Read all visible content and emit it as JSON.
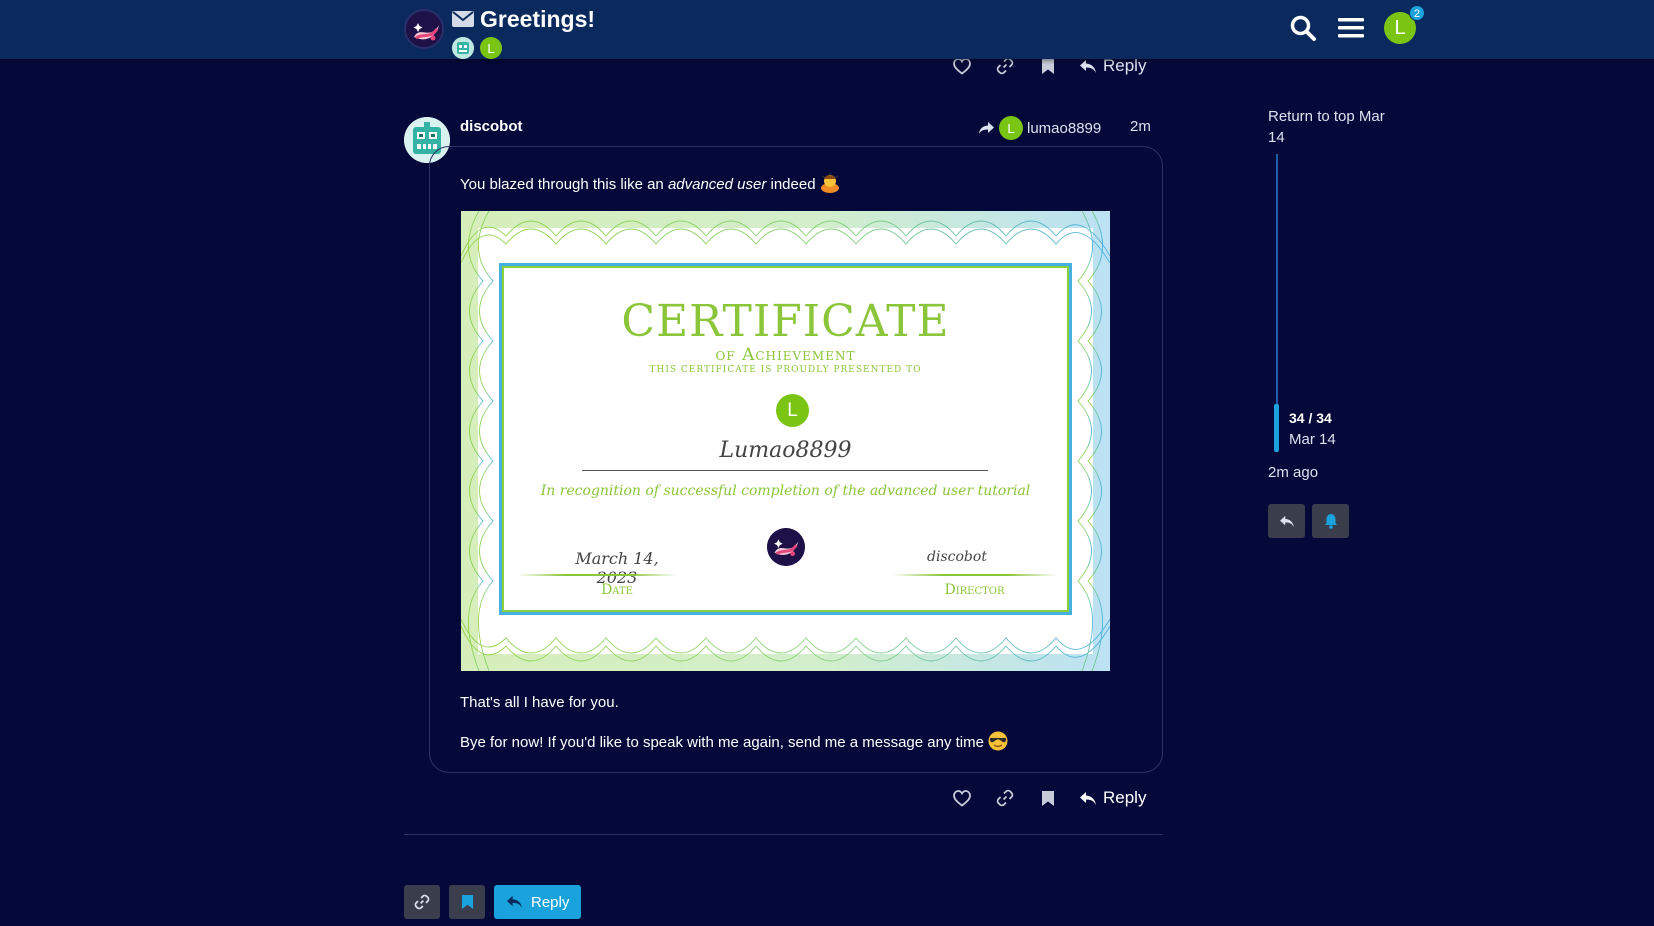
{
  "header": {
    "topic_title": "Greetings!",
    "participants": [
      {
        "name": "discobot",
        "initial": ""
      },
      {
        "name": "lumao8899",
        "initial": "L"
      }
    ],
    "user_initial": "L",
    "notification_count": "2"
  },
  "top_actions": {
    "reply_label": "Reply"
  },
  "post": {
    "username": "discobot",
    "reply_to_initial": "L",
    "reply_to_user": "lumao8899",
    "date": "2m",
    "text_before": "You blazed through this like an ",
    "text_em": "advanced user",
    "text_after": " indeed",
    "line2": "That's all I have for you.",
    "line3": "Bye for now! If you'd like to speak with me again, send me a message any time",
    "reply_label": "Reply"
  },
  "certificate": {
    "title": "CERTIFICATE",
    "subtitle": "of Achievement",
    "presented": "this certificate is proudly presented to",
    "avatar_initial": "L",
    "recipient": "Lumao8899",
    "recognition": "In recognition of successful completion of the advanced user tutorial",
    "date_value": "March 14, 2023",
    "date_label": "Date",
    "director_value": "discobot",
    "director_label": "Director"
  },
  "bottom": {
    "reply_label": "Reply"
  },
  "timeline": {
    "return_top": "Return to top Mar 14",
    "count": "34 / 34",
    "date": "Mar 14",
    "ago": "2m ago"
  },
  "colors": {
    "background": "#05093a",
    "header": "#0a2a5e",
    "accent": "#1aa2dc",
    "avatar_green": "#7ac414",
    "cert_green": "#8bc53a",
    "cert_blue": "#44b1e2"
  }
}
